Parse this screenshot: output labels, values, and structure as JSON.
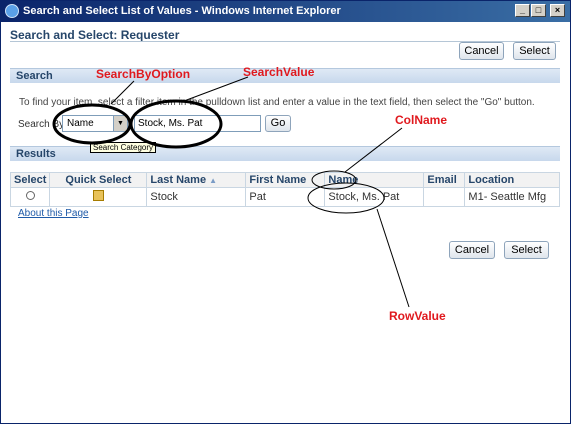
{
  "window": {
    "title": "Search and Select List of Values - Windows Internet Explorer",
    "controls": {
      "minimize": "_",
      "maximize": "□",
      "close": "×"
    }
  },
  "page": {
    "title": "Search and Select: Requester",
    "cancel_label": "Cancel",
    "select_label": "Select"
  },
  "search": {
    "section_title": "Search",
    "instructions": "To find your item, select a filter item in the pulldown list and enter a value in the text field, then select the \"Go\" button.",
    "search_by_label": "Search By",
    "selected_option": "Name",
    "value": "Stock, Ms. Pat",
    "go_label": "Go",
    "tooltip": "Search Category"
  },
  "results": {
    "section_title": "Results",
    "columns": [
      "Select",
      "Quick Select",
      "Last Name",
      "First Name",
      "Name",
      "Email",
      "Location"
    ],
    "rows": [
      {
        "last_name": "Stock",
        "first_name": "Pat",
        "name": "Stock, Ms. Pat",
        "email": "",
        "location": "M1- Seattle Mfg"
      }
    ]
  },
  "about_link": "About this Page",
  "footer": {
    "cancel_label": "Cancel",
    "select_label": "Select"
  },
  "annotations": {
    "search_by_option": "SearchByOption",
    "search_value": "SearchValue",
    "col_name": "ColName",
    "row_value": "RowValue",
    "color": "#e0191e"
  }
}
